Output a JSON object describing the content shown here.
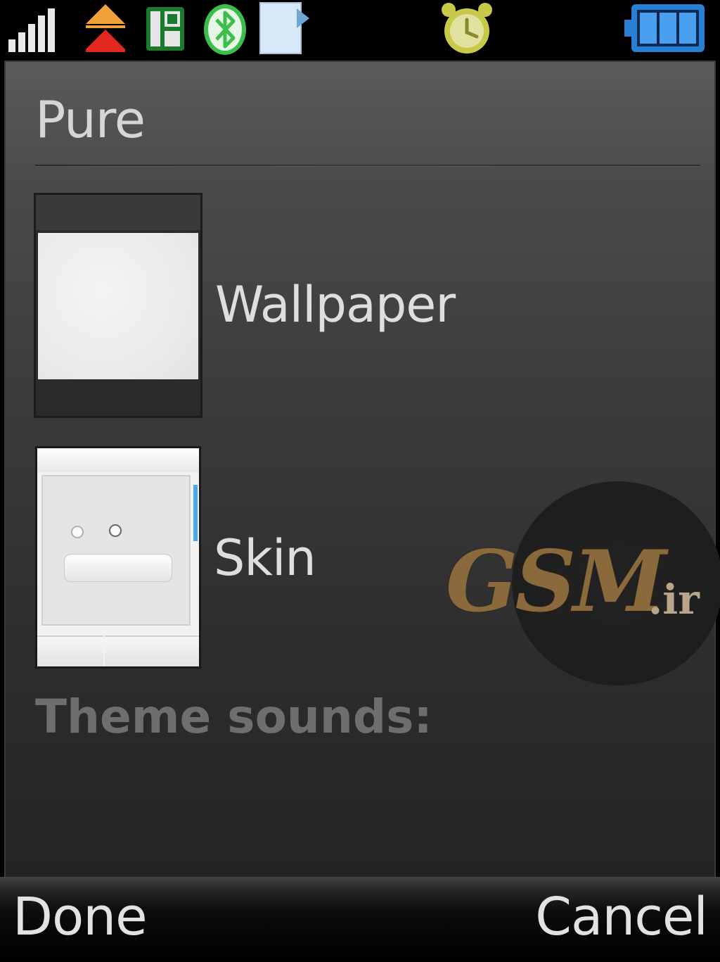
{
  "status_bar": {
    "icons": [
      "signal-strength-icon",
      "data-transfer-icon",
      "sim-card-icon",
      "bluetooth-icon",
      "document-icon",
      "alarm-clock-icon",
      "battery-icon"
    ],
    "colors": {
      "alarm": "#c8c84a",
      "bluetooth": "#3cbf4a",
      "battery": "#2a7fd4"
    }
  },
  "screen": {
    "title": "Pure",
    "items": [
      {
        "label": "Wallpaper",
        "thumbnail": "wallpaper-preview"
      },
      {
        "label": "Skin",
        "thumbnail": "skin-preview"
      }
    ],
    "section_label": "Theme sounds:"
  },
  "watermark": {
    "main": "GSM",
    "suffix": ".ir"
  },
  "softkeys": {
    "left": "Done",
    "right": "Cancel"
  }
}
